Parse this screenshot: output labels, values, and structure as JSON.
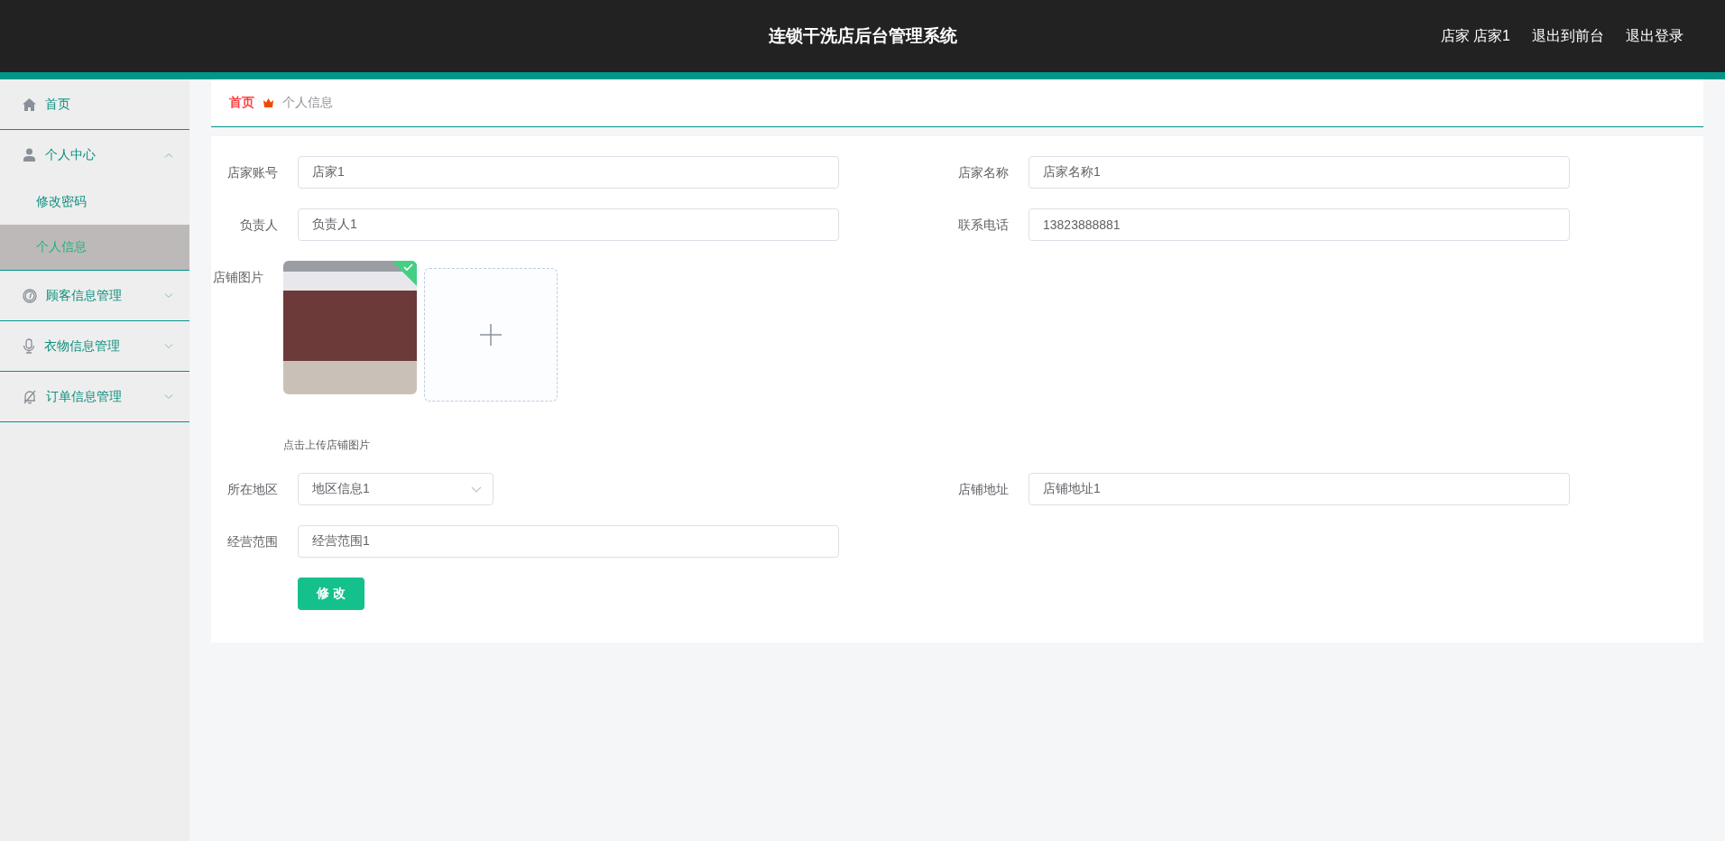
{
  "header": {
    "title": "连锁干洗店后台管理系统",
    "links": [
      "店家 店家1",
      "退出到前台",
      "退出登录"
    ]
  },
  "sidebar": {
    "items": [
      {
        "label": "首页"
      },
      {
        "label": "个人中心",
        "expanded": true,
        "children": [
          {
            "label": "修改密码",
            "selected": false
          },
          {
            "label": "个人信息",
            "selected": true
          }
        ]
      },
      {
        "label": "顾客信息管理",
        "expanded": false
      },
      {
        "label": "衣物信息管理",
        "expanded": false
      },
      {
        "label": "订单信息管理",
        "expanded": false
      }
    ]
  },
  "breadcrumb": {
    "home": "首页",
    "current": "个人信息"
  },
  "form": {
    "fields": [
      {
        "kind": "text",
        "label": "店家账号",
        "value": "店家1"
      },
      {
        "kind": "text",
        "label": "店家名称",
        "value": "店家名称1"
      },
      {
        "kind": "text",
        "label": "负责人",
        "value": "负责人1"
      },
      {
        "kind": "text",
        "label": "联系电话",
        "value": "13823888881"
      },
      {
        "kind": "image",
        "label": "店铺图片",
        "hint": "点击上传店铺图片"
      },
      {
        "kind": "select",
        "label": "所在地区",
        "value": "地区信息1"
      },
      {
        "kind": "text",
        "label": "店铺地址",
        "value": "店铺地址1"
      },
      {
        "kind": "text",
        "label": "经营范围",
        "value": "经营范围1"
      }
    ],
    "submit": "修 改"
  }
}
